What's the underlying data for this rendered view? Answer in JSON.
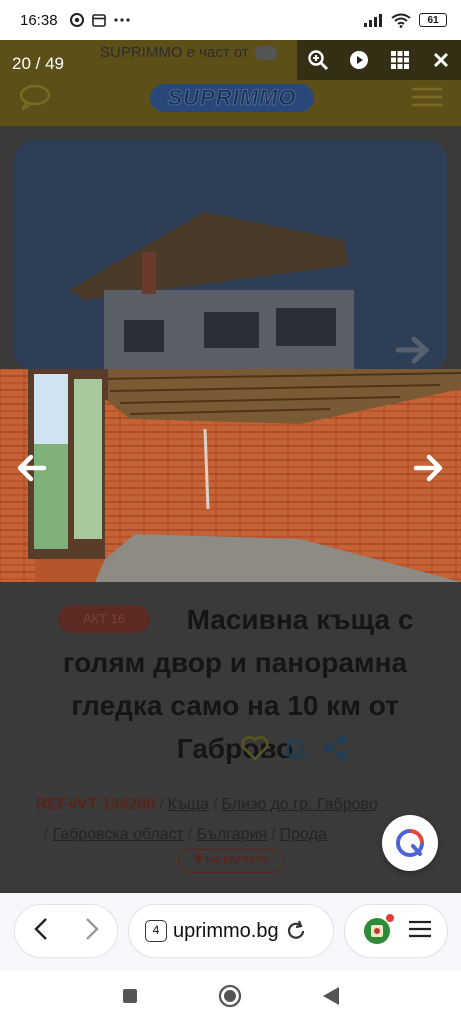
{
  "status_bar": {
    "time": "16:38",
    "notification_icons": [
      "chrome-icon",
      "calendar-icon",
      "more-dots"
    ],
    "signal": "signal-icon",
    "wifi": "wifi-icon",
    "battery": "61"
  },
  "site": {
    "notice_text": "SUPRIMMO е част от",
    "logo_text": "SUPRIMMO"
  },
  "viewer": {
    "counter": "20 / 49",
    "tools": [
      "zoom-in-icon",
      "play-icon",
      "grid-icon",
      "close-icon"
    ],
    "watermark": "SUPRIMMO"
  },
  "listing": {
    "badge": "АКТ 16",
    "title": "Масивна къща с голям двор и панорамна гледка само на 10 км от Габрово",
    "ref": "REF#VT 134280",
    "breadcrumb": [
      "Къща",
      "Близо до гр. Габрово",
      "Габровска област",
      "България",
      "Прода"
    ],
    "map_link": "НА КАРТАТА"
  },
  "browser": {
    "tab_count": "4",
    "url": "uprimmo.bg"
  },
  "colors": {
    "accent_brand_yellow": "#f2c400",
    "brand_blue": "#2b5aa8",
    "accent_red": "#b53b2a",
    "overlay_dim": "#3a3a3a"
  }
}
